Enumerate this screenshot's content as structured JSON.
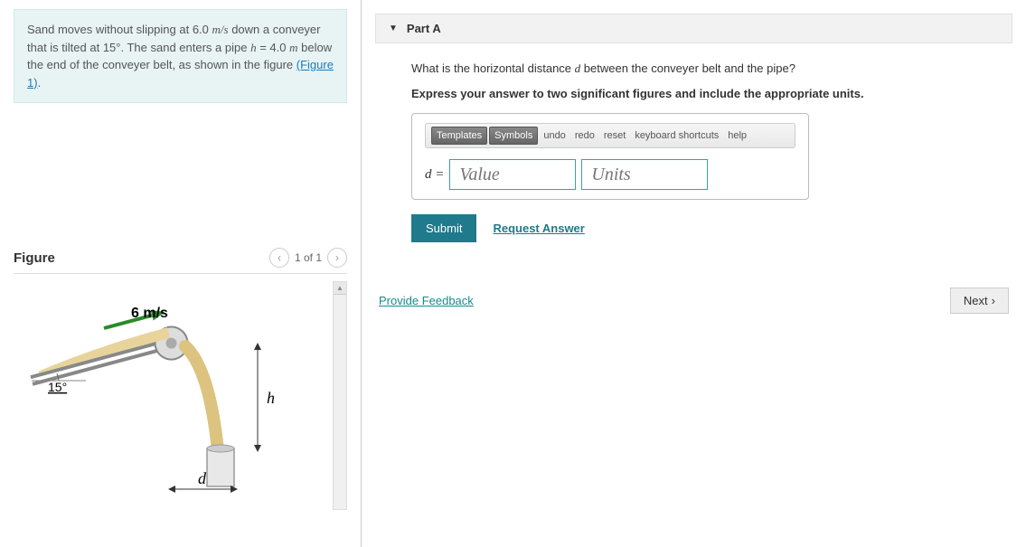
{
  "problem": {
    "text_before_speed": "Sand moves without slipping at ",
    "speed_value": "6.0",
    "speed_unit": "m/s",
    "text_after_speed": " down a conveyer that is tilted at ",
    "angle": "15°",
    "text_after_angle": ". The sand enters a pipe ",
    "h_symbol": "h",
    "equals": " = ",
    "h_value": "4.0",
    "h_unit": "m",
    "text_end": " below the end of the conveyer belt, as shown in the figure ",
    "figure_link": "(Figure 1)",
    "period": "."
  },
  "figure": {
    "title": "Figure",
    "nav_text": "1 of 1",
    "labels": {
      "speed": "6 m/s",
      "angle": "15°",
      "h": "h",
      "d": "d"
    }
  },
  "part": {
    "title": "Part A",
    "question_before_d": "What is the horizontal distance ",
    "d_symbol": "d",
    "question_after_d": " between the conveyer belt and the pipe?",
    "instruction": "Express your answer to two significant figures and include the appropriate units."
  },
  "toolbar": {
    "templates": "Templates",
    "symbols": "Symbols",
    "undo": "undo",
    "redo": "redo",
    "reset": "reset",
    "keyboard": "keyboard shortcuts",
    "help": "help"
  },
  "answer": {
    "label": "d = ",
    "value_placeholder": "Value",
    "units_placeholder": "Units"
  },
  "buttons": {
    "submit": "Submit",
    "request_answer": "Request Answer",
    "provide_feedback": "Provide Feedback",
    "next": "Next"
  }
}
